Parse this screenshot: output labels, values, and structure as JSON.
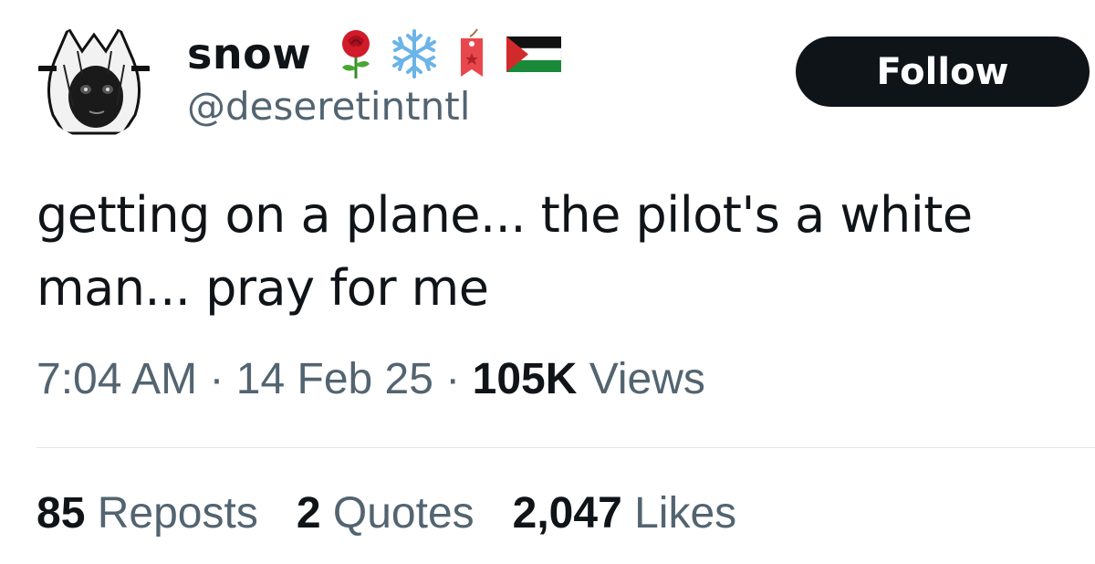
{
  "tweet": {
    "author": {
      "display_name": "snow",
      "handle": "@deseretintntl",
      "name_emojis": [
        "rose-icon",
        "snowflake-icon",
        "bookmark-tag-icon",
        "palestine-flag-icon"
      ]
    },
    "follow_label": "Follow",
    "text": "getting on a plane... the pilot's a white man... pray for me",
    "meta": {
      "time": "7:04 AM",
      "separator": "·",
      "date": "14 Feb 25",
      "views_count": "105K",
      "views_label": "Views"
    },
    "stats": {
      "reposts_count": "85",
      "reposts_label": "Reposts",
      "quotes_count": "2",
      "quotes_label": "Quotes",
      "likes_count": "2,047",
      "likes_label": "Likes"
    }
  },
  "colors": {
    "text_primary": "#0f1419",
    "text_secondary": "#536471",
    "button_bg": "#0f1419",
    "button_text": "#ffffff",
    "divider": "#e1e6ea"
  }
}
